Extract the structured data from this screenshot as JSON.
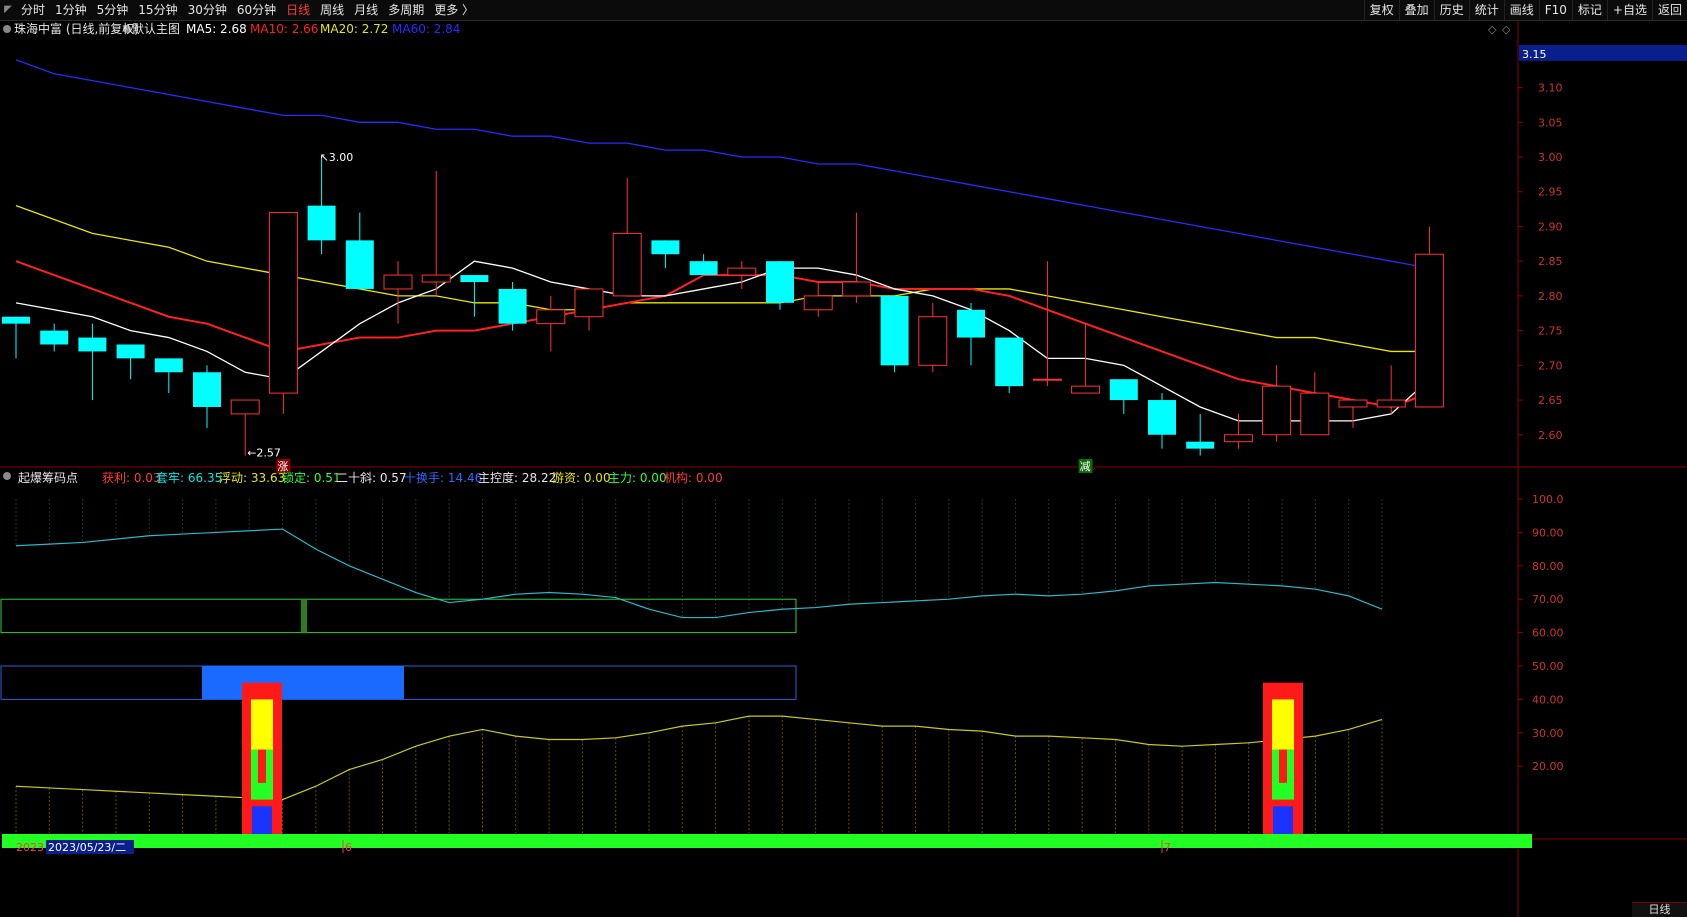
{
  "toolbar": {
    "periods": [
      "分时",
      "1分钟",
      "5分钟",
      "15分钟",
      "30分钟",
      "60分钟",
      "日线",
      "周线",
      "月线",
      "多周期",
      "更多 〉"
    ],
    "active_period": "日线",
    "right_buttons": [
      "复权",
      "叠加",
      "历史",
      "统计",
      "画线",
      "F10",
      "标记",
      "+自选",
      "返回"
    ]
  },
  "main_header": {
    "stock": "珠海中富 (日线,前复权)",
    "theme": "默认主图",
    "ma5": "MA5: 2.68",
    "ma10": "MA10: 2.66",
    "ma20": "MA20: 2.72",
    "ma60": "MA60: 2.84"
  },
  "price_axis": {
    "current_price": "3.15",
    "ticks": [
      "3.10",
      "3.05",
      "3.00",
      "2.95",
      "2.90",
      "2.85",
      "2.80",
      "2.75",
      "2.70",
      "2.65",
      "2.60"
    ]
  },
  "annotations": {
    "high": "3.00",
    "low": "2.57",
    "mark_up": "涨",
    "mark_down": "减"
  },
  "indicator_header": {
    "name": "起爆筹码点",
    "profit": "获利: 0.03",
    "trapped": "套牢: 66.35",
    "floating": "浮动: 33.63",
    "locked": "锁定: 0.51",
    "twenty_slope": "二十斜: 0.57",
    "ten_turnover": "十换手: 14.46",
    "control": "主控度: 28.22",
    "retail": "游资: 0.00",
    "main_force": "主力: 0.00",
    "institution": "机构: 0.00"
  },
  "indicator_axis": {
    "ticks": [
      "100.0",
      "90.00",
      "80.00",
      "70.00",
      "60.00",
      "50.00",
      "40.00",
      "30.00",
      "20.00"
    ]
  },
  "date_axis": {
    "year": "2023",
    "date": "2023/05/23/二",
    "month_6": "6",
    "month_7": "7"
  },
  "bottom_label": "日线",
  "colors": {
    "up": "#ff3232",
    "down": "#00ffff",
    "ma5": "#ffffff",
    "ma10": "#ff2020",
    "ma20": "#e8e800",
    "ma60": "#2a2aff"
  },
  "chart_data": {
    "type": "candlestick",
    "ohlc": [
      [
        2.77,
        2.77,
        2.71,
        2.76
      ],
      [
        2.75,
        2.76,
        2.72,
        2.73
      ],
      [
        2.74,
        2.76,
        2.65,
        2.72
      ],
      [
        2.73,
        2.73,
        2.68,
        2.71
      ],
      [
        2.71,
        2.71,
        2.66,
        2.69
      ],
      [
        2.69,
        2.7,
        2.61,
        2.64
      ],
      [
        2.63,
        2.65,
        2.57,
        2.65
      ],
      [
        2.66,
        2.92,
        2.63,
        2.92
      ],
      [
        2.93,
        3.0,
        2.86,
        2.88
      ],
      [
        2.88,
        2.92,
        2.81,
        2.81
      ],
      [
        2.81,
        2.85,
        2.76,
        2.83
      ],
      [
        2.82,
        2.98,
        2.8,
        2.83
      ],
      [
        2.83,
        2.83,
        2.77,
        2.82
      ],
      [
        2.81,
        2.82,
        2.75,
        2.76
      ],
      [
        2.76,
        2.8,
        2.72,
        2.78
      ],
      [
        2.77,
        2.81,
        2.75,
        2.81
      ],
      [
        2.8,
        2.97,
        2.8,
        2.89
      ],
      [
        2.88,
        2.88,
        2.84,
        2.86
      ],
      [
        2.85,
        2.86,
        2.83,
        2.83
      ],
      [
        2.83,
        2.85,
        2.81,
        2.84
      ],
      [
        2.85,
        2.85,
        2.78,
        2.79
      ],
      [
        2.78,
        2.82,
        2.77,
        2.8
      ],
      [
        2.8,
        2.92,
        2.79,
        2.82
      ],
      [
        2.8,
        2.8,
        2.69,
        2.7
      ],
      [
        2.7,
        2.79,
        2.69,
        2.77
      ],
      [
        2.78,
        2.79,
        2.7,
        2.74
      ],
      [
        2.74,
        2.74,
        2.66,
        2.67
      ],
      [
        2.68,
        2.85,
        2.67,
        2.68
      ],
      [
        2.66,
        2.76,
        2.66,
        2.67
      ],
      [
        2.68,
        2.68,
        2.63,
        2.65
      ],
      [
        2.65,
        2.66,
        2.58,
        2.6
      ],
      [
        2.59,
        2.63,
        2.57,
        2.58
      ],
      [
        2.59,
        2.63,
        2.58,
        2.6
      ],
      [
        2.6,
        2.7,
        2.59,
        2.67
      ],
      [
        2.6,
        2.69,
        2.6,
        2.66
      ],
      [
        2.64,
        2.65,
        2.61,
        2.65
      ],
      [
        2.64,
        2.7,
        2.63,
        2.65
      ],
      [
        2.64,
        2.9,
        2.64,
        2.86
      ]
    ],
    "ma5": [
      2.79,
      2.78,
      2.77,
      2.75,
      2.74,
      2.72,
      2.69,
      2.68,
      2.72,
      2.76,
      2.79,
      2.81,
      2.85,
      2.84,
      2.82,
      2.81,
      2.8,
      2.8,
      2.81,
      2.82,
      2.84,
      2.84,
      2.83,
      2.81,
      2.8,
      2.78,
      2.75,
      2.71,
      2.71,
      2.7,
      2.67,
      2.64,
      2.62,
      2.62,
      2.62,
      2.62,
      2.63,
      2.68
    ],
    "ma10": [
      2.85,
      2.83,
      2.81,
      2.79,
      2.77,
      2.76,
      2.74,
      2.72,
      2.73,
      2.74,
      2.74,
      2.75,
      2.75,
      2.76,
      2.77,
      2.78,
      2.79,
      2.8,
      2.83,
      2.83,
      2.83,
      2.82,
      2.82,
      2.81,
      2.81,
      2.81,
      2.8,
      2.78,
      2.76,
      2.74,
      2.72,
      2.7,
      2.68,
      2.67,
      2.66,
      2.65,
      2.64,
      2.66
    ],
    "ma20": [
      2.93,
      2.91,
      2.89,
      2.88,
      2.87,
      2.85,
      2.84,
      2.83,
      2.82,
      2.81,
      2.8,
      2.8,
      2.79,
      2.79,
      2.78,
      2.78,
      2.79,
      2.79,
      2.79,
      2.79,
      2.79,
      2.8,
      2.8,
      2.8,
      2.81,
      2.81,
      2.81,
      2.8,
      2.79,
      2.78,
      2.77,
      2.76,
      2.75,
      2.74,
      2.74,
      2.73,
      2.72,
      2.72
    ],
    "ma60": [
      3.14,
      3.12,
      3.11,
      3.1,
      3.09,
      3.08,
      3.07,
      3.06,
      3.06,
      3.05,
      3.05,
      3.04,
      3.04,
      3.03,
      3.03,
      3.02,
      3.02,
      3.01,
      3.01,
      3.0,
      3.0,
      2.99,
      2.99,
      2.98,
      2.97,
      2.96,
      2.95,
      2.94,
      2.93,
      2.92,
      2.91,
      2.9,
      2.89,
      2.88,
      2.87,
      2.86,
      2.85,
      2.84
    ],
    "price_ylim": [
      2.555,
      3.17
    ],
    "trapped_line": [
      86,
      86.5,
      87,
      88,
      89,
      89.5,
      90,
      90.5,
      91,
      85,
      80,
      76,
      72,
      69,
      70,
      71.5,
      72,
      71.5,
      70.5,
      67,
      64.5,
      64.5,
      66,
      67,
      67.5,
      68.5,
      69,
      69.5,
      70,
      71,
      71.5,
      71,
      71.5,
      72.5,
      74,
      74.5,
      75,
      74.5,
      74,
      73,
      71,
      67
    ],
    "floating_line": [
      14,
      13.5,
      13,
      12.5,
      12,
      11.5,
      11,
      10.5,
      10,
      14,
      19,
      22,
      26,
      29,
      31,
      29,
      28,
      28,
      28.5,
      30,
      32,
      33,
      35,
      35,
      34,
      33,
      32,
      32,
      31,
      30.5,
      29,
      29,
      28.5,
      28,
      26.5,
      26,
      26.5,
      27,
      28,
      29,
      31,
      34
    ],
    "indicator_ylim": [
      0,
      103
    ]
  }
}
